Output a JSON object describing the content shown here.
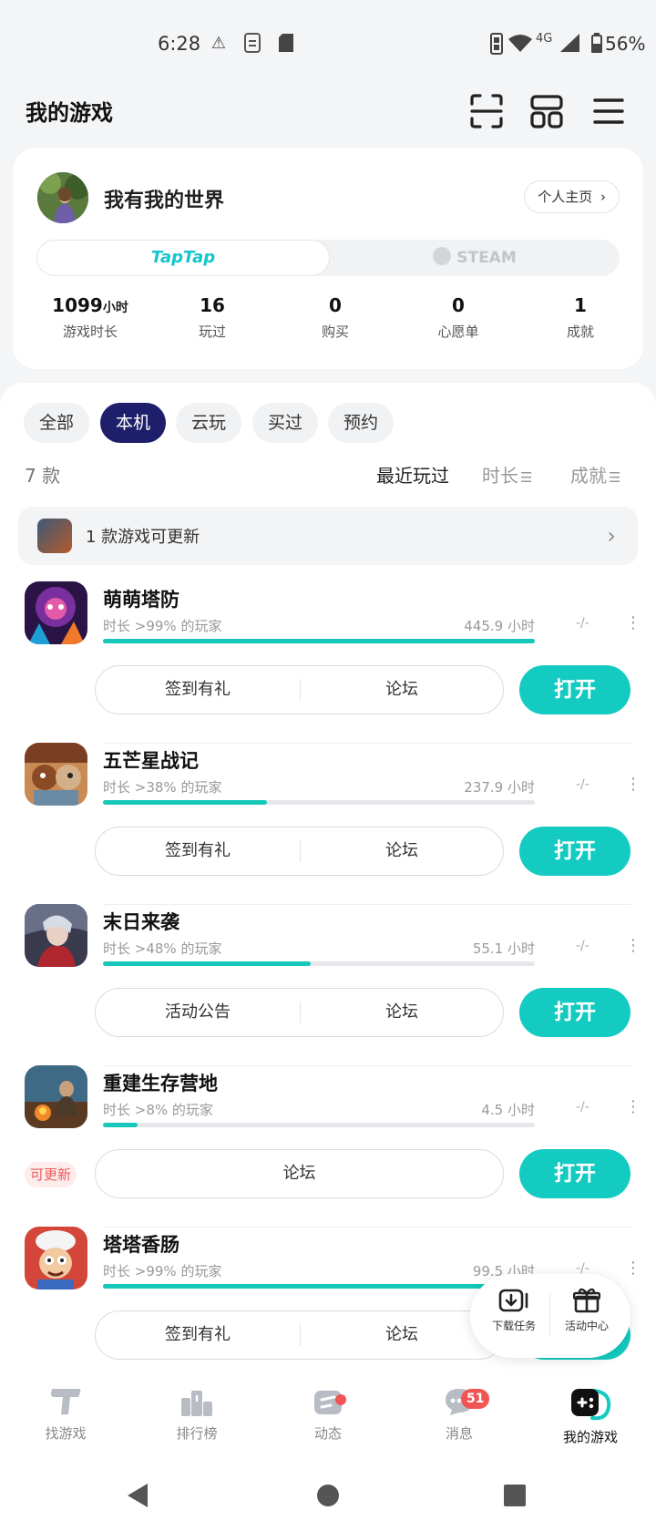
{
  "status_bar": {
    "time": "6:28",
    "battery": "56%",
    "network": "4G"
  },
  "header": {
    "title": "我的游戏"
  },
  "profile": {
    "name": "我有我的世界",
    "homepage_label": "个人主页",
    "platforms": [
      "TapTap",
      "STEAM"
    ],
    "stats": [
      {
        "value": "1099",
        "unit": "小时",
        "label": "游戏时长"
      },
      {
        "value": "16",
        "unit": "",
        "label": "玩过"
      },
      {
        "value": "0",
        "unit": "",
        "label": "购买"
      },
      {
        "value": "0",
        "unit": "",
        "label": "心愿单"
      },
      {
        "value": "1",
        "unit": "",
        "label": "成就"
      }
    ]
  },
  "filters": [
    "全部",
    "本机",
    "云玩",
    "买过",
    "预约"
  ],
  "active_filter": "本机",
  "list": {
    "count": "7 款",
    "sort": [
      "最近玩过",
      "时长",
      "成就"
    ],
    "update_banner": "1 款游戏可更新"
  },
  "games": [
    {
      "name": "萌萌塔防",
      "sub": "时长 >99% 的玩家",
      "hours": "445.9 小时",
      "dash": "-/-",
      "progress": 1.0,
      "actions": [
        "签到有礼",
        "论坛"
      ],
      "open": "打开",
      "badge": ""
    },
    {
      "name": "五芒星战记",
      "sub": "时长 >38% 的玩家",
      "hours": "237.9 小时",
      "dash": "-/-",
      "progress": 0.38,
      "actions": [
        "签到有礼",
        "论坛"
      ],
      "open": "打开",
      "badge": ""
    },
    {
      "name": "末日来袭",
      "sub": "时长 >48% 的玩家",
      "hours": "55.1 小时",
      "dash": "-/-",
      "progress": 0.48,
      "actions": [
        "活动公告",
        "论坛"
      ],
      "open": "打开",
      "badge": ""
    },
    {
      "name": "重建生存营地",
      "sub": "时长 >8% 的玩家",
      "hours": "4.5 小时",
      "dash": "-/-",
      "progress": 0.08,
      "actions": [
        "论坛"
      ],
      "open": "打开",
      "badge": "可更新"
    },
    {
      "name": "塔塔香肠",
      "sub": "时长 >99% 的玩家",
      "hours": "99.5 小时",
      "dash": "-/-",
      "progress": 1.0,
      "actions": [
        "签到有礼",
        "论坛"
      ],
      "open": "打开",
      "badge": ""
    }
  ],
  "float_panel": {
    "download": "下载任务",
    "activity": "活动中心"
  },
  "nav": {
    "items": [
      "找游戏",
      "排行榜",
      "动态",
      "消息",
      "我的游戏"
    ],
    "message_count": "51",
    "active": "我的游戏"
  },
  "colors": {
    "accent": "#14cbc1",
    "active_chip": "#1d1f6b",
    "badge": "#f25454"
  }
}
